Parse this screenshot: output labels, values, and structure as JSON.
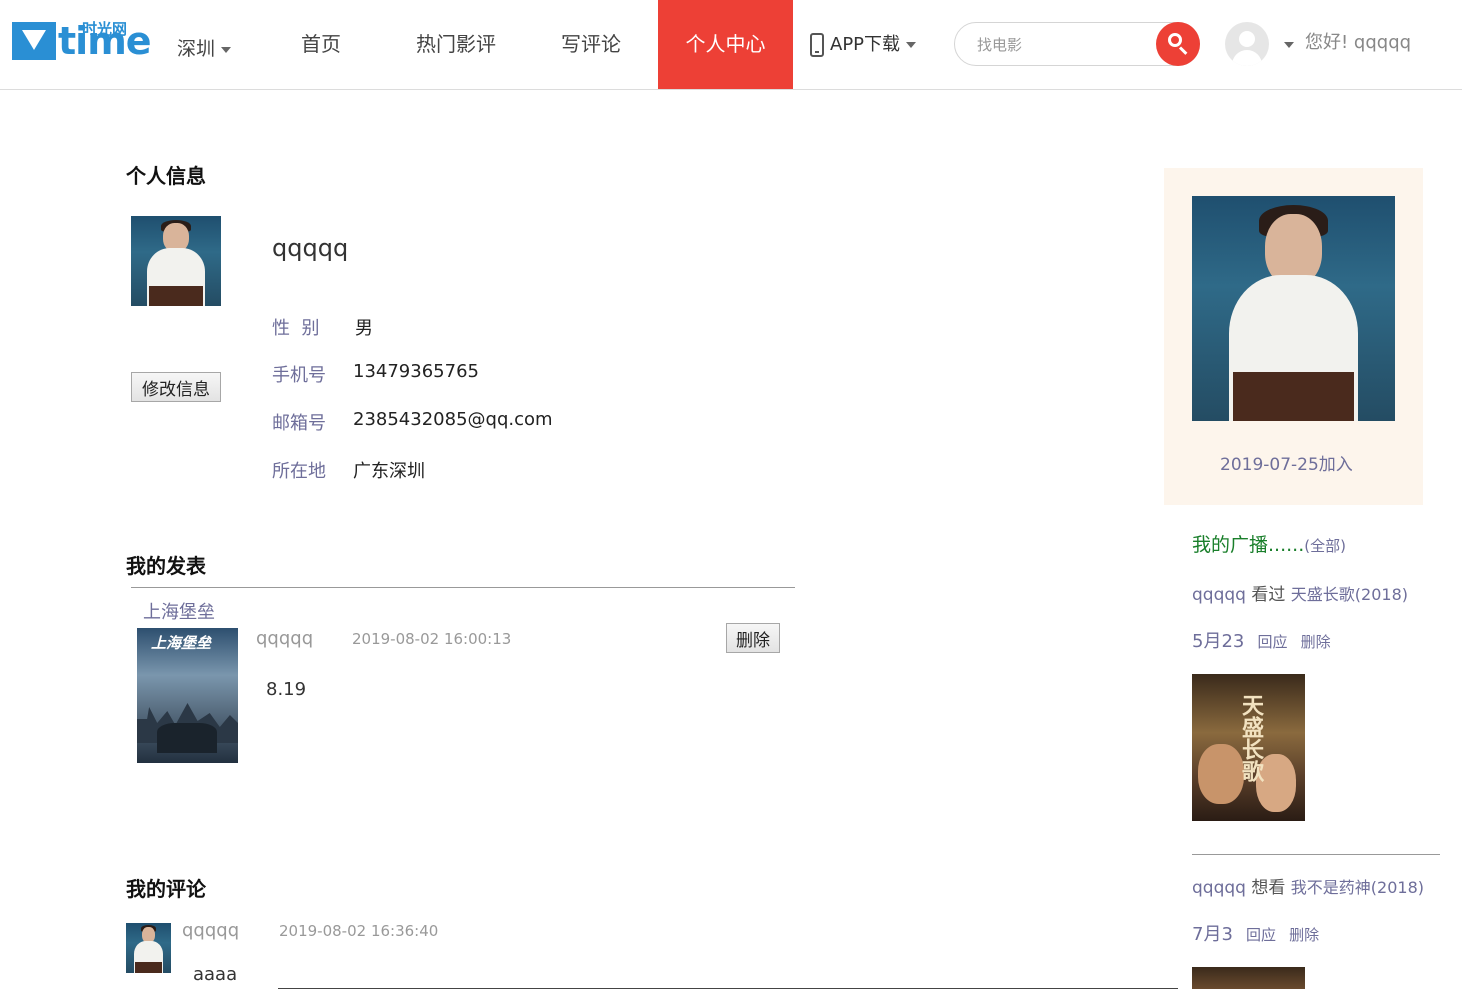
{
  "header": {
    "logo_text": "time",
    "logo_cn": "时光网",
    "city": "深圳",
    "nav": [
      "首页",
      "热门影评",
      "写评论",
      "个人中心"
    ],
    "active_nav": "个人中心",
    "app_download": "APP下载",
    "search_placeholder": "找电影",
    "greeting": "您好! qqqqq",
    "accent_color": "#ed4036"
  },
  "profile": {
    "section_title": "个人信息",
    "username": "qqqqq",
    "edit_button": "修改信息",
    "fields": [
      {
        "label": "性  别",
        "value": "男"
      },
      {
        "label": "手机号",
        "value": "13479365765"
      },
      {
        "label": "邮箱号",
        "value": "2385432085@qq.com"
      },
      {
        "label": "所在地",
        "value": "广东深圳"
      }
    ]
  },
  "posts": {
    "section_title": "我的发表",
    "items": [
      {
        "movie": "上海堡垒",
        "poster_title": "上海堡垒",
        "user": "qqqqq",
        "time": "2019-08-02 16:00:13",
        "score": "8.19",
        "delete_label": "删除"
      }
    ]
  },
  "comments": {
    "section_title": "我的评论",
    "items": [
      {
        "user": "qqqqq",
        "time": "2019-08-02 16:36:40",
        "text": "aaaa"
      }
    ]
  },
  "sidebar": {
    "join_text": "2019-07-25加入",
    "broadcast_title": "我的广播......",
    "broadcast_all": "(全部)",
    "feed": [
      {
        "user": "qqqqq",
        "action": "看过",
        "movie": "天盛长歌(2018)",
        "date": "5月23",
        "reply": "回应",
        "delete": "删除",
        "poster_title": "天盛长歌"
      },
      {
        "user": "qqqqq",
        "action": "想看",
        "movie": "我不是药神(2018)",
        "date": "7月3",
        "reply": "回应",
        "delete": "删除"
      }
    ]
  }
}
